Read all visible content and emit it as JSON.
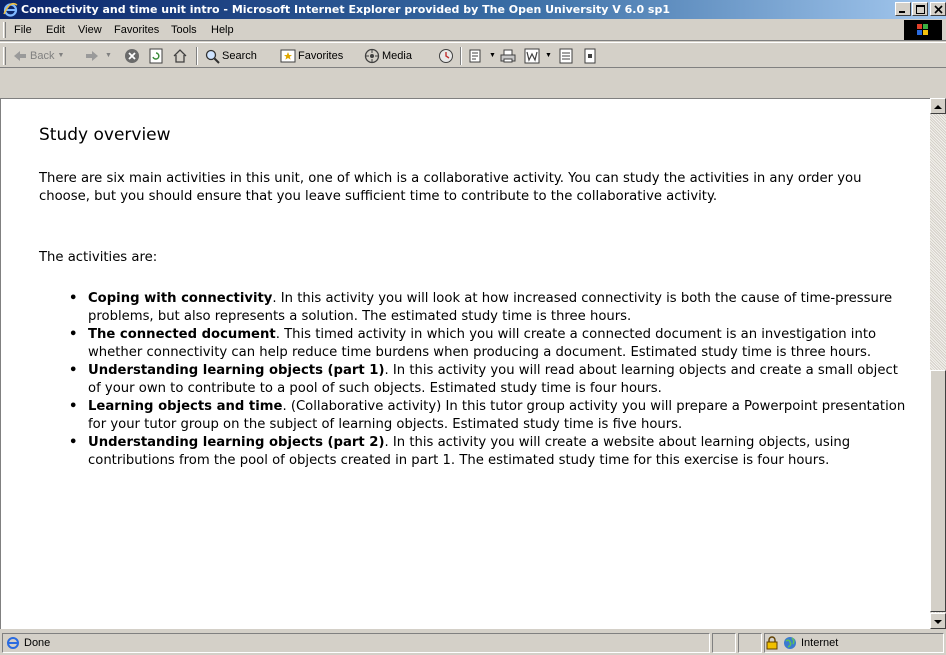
{
  "window": {
    "title": "Connectivity and time unit intro - Microsoft Internet Explorer provided by The Open University V 6.0 sp1"
  },
  "menu": {
    "items": [
      "File",
      "Edit",
      "View",
      "Favorites",
      "Tools",
      "Help"
    ]
  },
  "toolbar": {
    "back_label": "Back",
    "search_label": "Search",
    "favorites_label": "Favorites",
    "media_label": "Media"
  },
  "page": {
    "heading": "Study overview",
    "intro": "There are six main activities in this unit, one of which is a collaborative activity. You can study the activities in any order you choose, but you should ensure that you leave sufficient time to contribute to the collaborative activity.",
    "activities_intro": "The activities are:",
    "activities": [
      {
        "title": "Coping with connectivity",
        "text": ". In this activity you will look at how increased connectivity is both the cause of time-pressure problems, but also represents a solution. The estimated study time is three hours."
      },
      {
        "title": "The connected document",
        "text": ". This timed activity in which you will create a connected document is an investigation into whether connectivity can help reduce time burdens when producing a document. Estimated study time is three hours."
      },
      {
        "title": "Understanding learning objects (part 1)",
        "text": ". In this activity you will read about learning objects and create a small object of your own to contribute to a pool of such objects. Estimated study time is four hours."
      },
      {
        "title": "Learning objects and time",
        "text": ". (Collaborative activity) In this tutor group activity you will prepare a Powerpoint presentation for your tutor group on the subject of learning objects. Estimated study time is five hours."
      },
      {
        "title": "Understanding learning objects (part 2)",
        "text": ". In this activity you will create a website about learning objects, using contributions from the pool of objects created in part 1. The estimated study time for this exercise is four hours."
      }
    ]
  },
  "status": {
    "text": "Done",
    "zone": "Internet"
  },
  "icons": {
    "app": "ie-icon",
    "status": "ie-page-icon",
    "lock": "lock-icon",
    "zone": "globe-icon"
  },
  "colors": {
    "titlebar_start": "#0a246a",
    "titlebar_end": "#a6caf0",
    "chrome": "#d4d0c8"
  }
}
